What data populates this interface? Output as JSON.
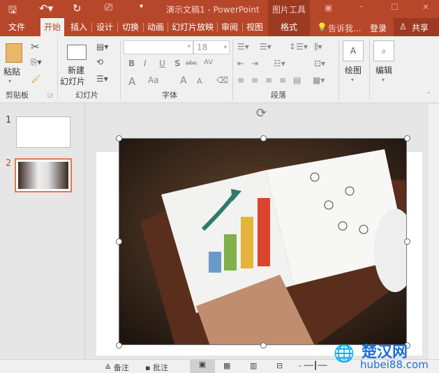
{
  "titlebar": {
    "title": "演示文稿1 - PowerPoint",
    "context_tab": "图片工具"
  },
  "tabs": [
    "文件",
    "开始",
    "插入",
    "设计",
    "切换",
    "动画",
    "幻灯片放映",
    "审阅",
    "视图",
    "格式"
  ],
  "tell_me": "告诉我...",
  "login": "登录",
  "share": "共享",
  "ribbon": {
    "clipboard": {
      "paste": "粘贴",
      "group": "剪贴板"
    },
    "slides": {
      "new_line1": "新建",
      "new_line2": "幻灯片",
      "group": "幻灯片"
    },
    "font": {
      "font_name": "",
      "font_size": "18",
      "bold": "B",
      "italic": "I",
      "underline": "U",
      "shadow": "S",
      "strike": "abc",
      "spacing": "AV",
      "color": "A",
      "case": "Aa",
      "grow": "A",
      "shrink": "A",
      "group": "字体"
    },
    "paragraph": {
      "group": "段落"
    },
    "drawing": {
      "label": "绘图"
    },
    "editing": {
      "label": "编辑"
    }
  },
  "slides_pane": [
    {
      "number": "1"
    },
    {
      "number": "2"
    }
  ],
  "status": {
    "notes": "备注",
    "comments": "批注"
  },
  "watermark": {
    "cn": "楚汉网",
    "url": "hubei88.com"
  }
}
